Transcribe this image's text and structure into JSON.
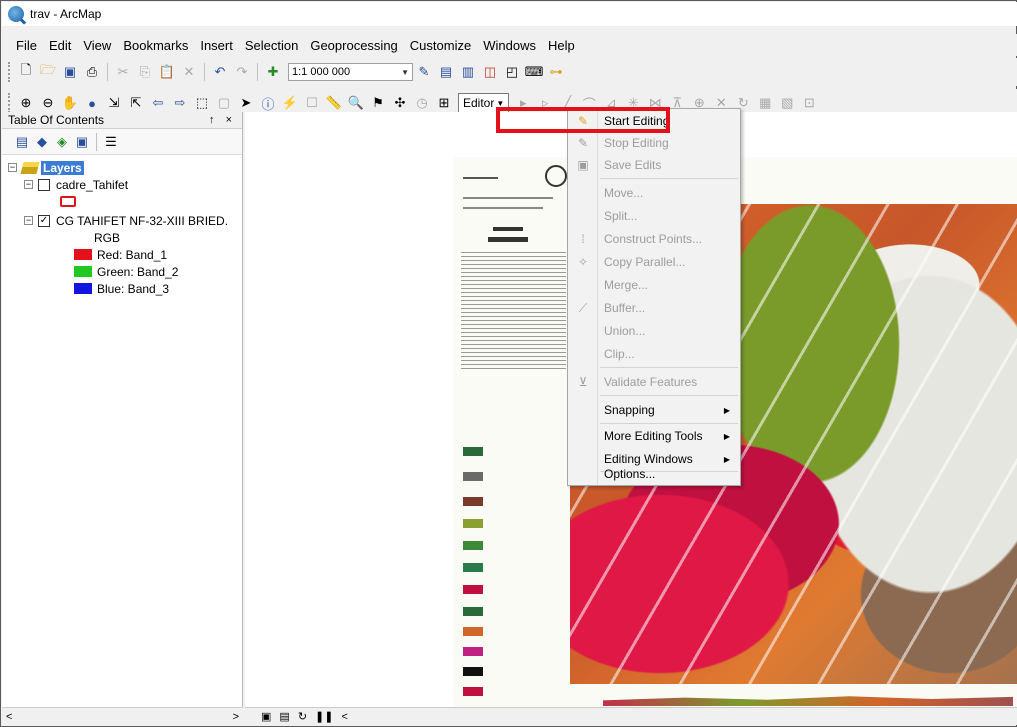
{
  "window": {
    "title": "trav - ArcMap"
  },
  "menubar": {
    "items": [
      "File",
      "Edit",
      "View",
      "Bookmarks",
      "Insert",
      "Selection",
      "Geoprocessing",
      "Customize",
      "Windows",
      "Help"
    ]
  },
  "toolbar": {
    "scale": "1:1 000 000",
    "editor_label": "Editor"
  },
  "toc": {
    "title": "Table Of Contents",
    "header_controls": "↑ ×",
    "root": "Layers",
    "layer1": "cadre_Tahifet",
    "layer2": "CG TAHIFET NF-32-XIII BRIED.",
    "layer2_sub": "RGB",
    "bands": [
      {
        "label": "Red:  Band_1",
        "color": "#e4111b"
      },
      {
        "label": "Green: Band_2",
        "color": "#22c822"
      },
      {
        "label": "Blue:  Band_3",
        "color": "#1414e0"
      }
    ]
  },
  "editor_menu": {
    "items": [
      {
        "label": "Start Editing",
        "enabled": true,
        "icon": "pencil-icon"
      },
      {
        "label": "Stop Editing",
        "enabled": false,
        "icon": "stop-edit-icon"
      },
      {
        "label": "Save Edits",
        "enabled": false,
        "icon": "save-icon"
      },
      {
        "label": "Move...",
        "enabled": false
      },
      {
        "label": "Split...",
        "enabled": false
      },
      {
        "label": "Construct Points...",
        "enabled": false,
        "icon": "construct-points-icon"
      },
      {
        "label": "Copy Parallel...",
        "enabled": false,
        "icon": "copy-parallel-icon"
      },
      {
        "label": "Merge...",
        "enabled": false
      },
      {
        "label": "Buffer...",
        "enabled": false,
        "icon": "buffer-icon"
      },
      {
        "label": "Union...",
        "enabled": false
      },
      {
        "label": "Clip...",
        "enabled": false
      },
      {
        "label": "Validate Features",
        "enabled": false,
        "icon": "validate-icon"
      },
      {
        "label": "Snapping",
        "enabled": true,
        "submenu": true
      },
      {
        "label": "More Editing Tools",
        "enabled": true,
        "submenu": true
      },
      {
        "label": "Editing Windows",
        "enabled": true,
        "submenu": true
      },
      {
        "label": "Options...",
        "enabled": true
      }
    ]
  },
  "colors": {
    "highlight": "#e4111b",
    "selection": "#3a7bd5"
  }
}
